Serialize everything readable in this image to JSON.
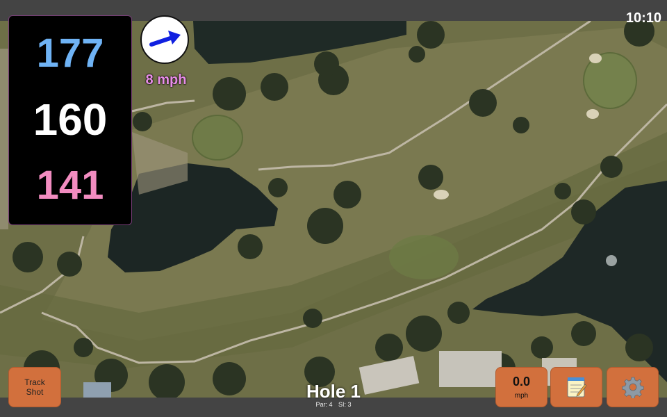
{
  "status": {
    "time": "10:10"
  },
  "distances": {
    "back": "177",
    "middle": "160",
    "front": "141"
  },
  "wind": {
    "speed_label": "8 mph",
    "icon": "wind-arrow-icon"
  },
  "hole": {
    "title": "Hole 1",
    "par": "Par: 4",
    "stroke_index": "SI: 3"
  },
  "buttons": {
    "track_shot_line1": "Track",
    "track_shot_line2": "Shot",
    "speed_value": "0.0",
    "speed_unit": "mph",
    "notes_icon": "notepad-icon",
    "settings_icon": "gear-icon"
  },
  "colors": {
    "back": "#6fb3f5",
    "middle": "#ffffff",
    "front": "#f28cc0",
    "wind": "#e88de8",
    "button": "#d2703d"
  }
}
